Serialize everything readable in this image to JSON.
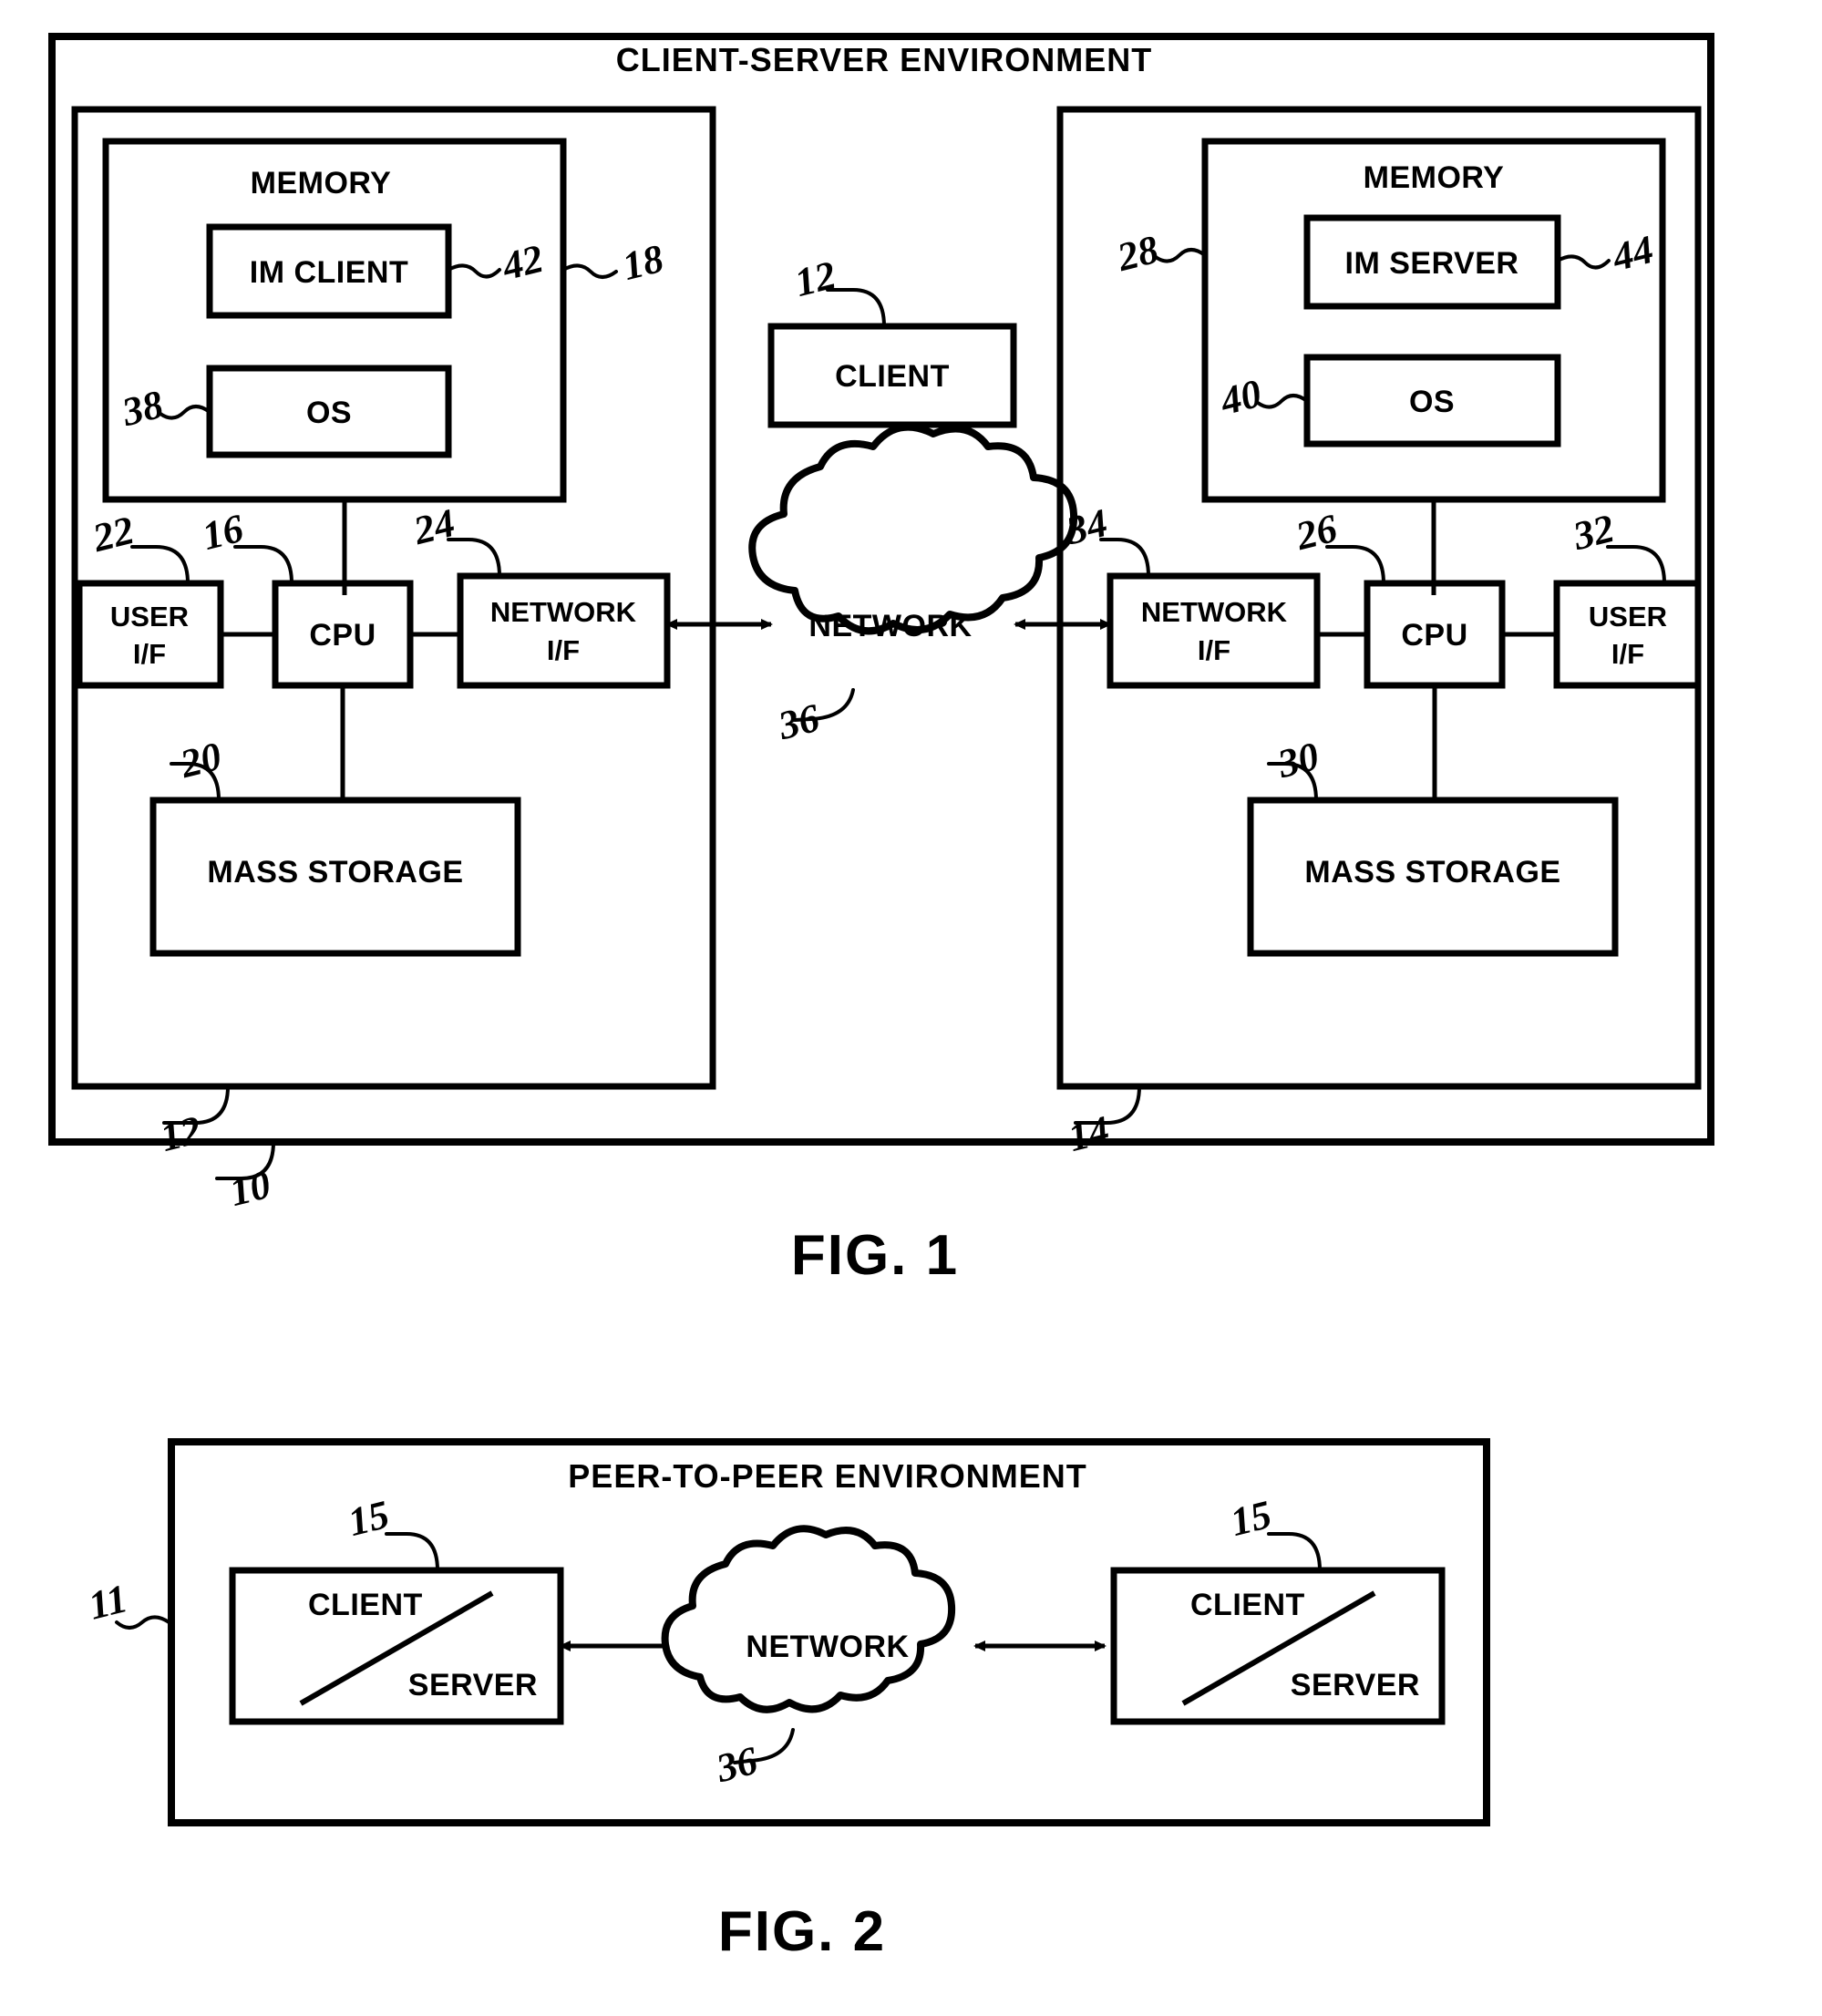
{
  "document": {
    "type": "patent-drawing-sheet",
    "figures": [
      {
        "caption": "FIG. 1",
        "title": "CLIENT-SERVER ENVIRONMENT",
        "ref": "10",
        "blocks": {
          "client_panel_ref": "12",
          "server_panel_ref": "14",
          "left_memory": "MEMORY",
          "left_memory_ref": "18",
          "im_client": "IM CLIENT",
          "im_client_ref": "42",
          "left_os": "OS",
          "left_os_ref": "38",
          "left_user_if": "USER I/F",
          "left_user_if_line1": "USER",
          "left_user_if_line2": "I/F",
          "left_user_if_ref": "22",
          "left_cpu": "CPU",
          "left_cpu_ref": "16",
          "left_network_if_line1": "NETWORK",
          "left_network_if_line2": "I/F",
          "left_network_if_ref": "24",
          "left_mass_storage": "MASS STORAGE",
          "left_mass_storage_ref": "20",
          "middle_client": "CLIENT",
          "middle_client_ref": "12",
          "network_cloud": "NETWORK",
          "network_cloud_ref": "36",
          "right_memory": "MEMORY",
          "right_memory_ref": "28",
          "im_server": "IM SERVER",
          "im_server_ref": "44",
          "right_os": "OS",
          "right_os_ref": "40",
          "right_network_if_line1": "NETWORK",
          "right_network_if_line2": "I/F",
          "right_network_if_ref": "34",
          "right_cpu": "CPU",
          "right_cpu_ref": "26",
          "right_user_if_line1": "USER",
          "right_user_if_line2": "I/F",
          "right_user_if_ref": "32",
          "right_mass_storage": "MASS STORAGE",
          "right_mass_storage_ref": "30"
        }
      },
      {
        "caption": "FIG. 2",
        "title": "PEER-TO-PEER ENVIRONMENT",
        "ref": "11",
        "blocks": {
          "left_peer_top": "CLIENT",
          "left_peer_bottom": "SERVER",
          "left_peer_ref": "15",
          "right_peer_top": "CLIENT",
          "right_peer_bottom": "SERVER",
          "right_peer_ref": "15",
          "network_cloud": "NETWORK",
          "network_cloud_ref": "36"
        }
      }
    ]
  },
  "colors": {
    "ink": "#000000",
    "paper": "#ffffff"
  }
}
